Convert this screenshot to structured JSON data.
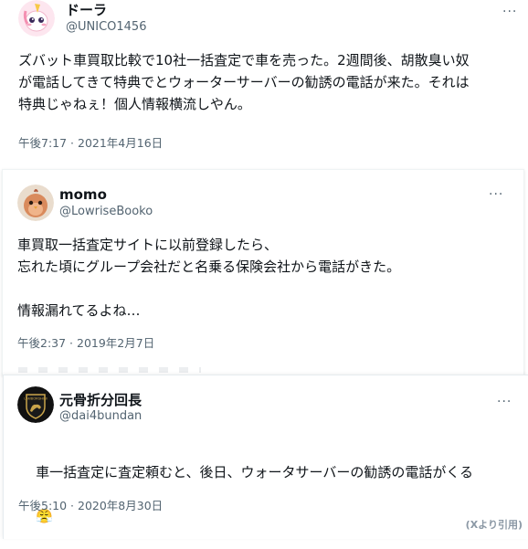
{
  "tweets": [
    {
      "name": "ドーラ",
      "handle": "@UNICO1456",
      "more_label": "···",
      "text": "ズバット車買取比較で10社一括査定で車を売った。2週間後、胡散臭い奴\nが電話してきて特典でとウォーターサーバーの勧誘の電話が来た。それは\n特典じゃねぇ！個人情報横流しやん。",
      "timestamp": "午後7:17 · 2021年4月16日",
      "avatar_icon": "unicorn-avatar"
    },
    {
      "name": "momo",
      "handle": "@LowriseBooko",
      "more_label": "···",
      "text": "車買取一括査定サイトに以前登録したら、\n忘れた頃にグループ会社だと名乗る保険会社から電話がきた。\n\n情報漏れてるよね…",
      "timestamp": "午後2:37 · 2019年2月7日",
      "avatar_icon": "bird-avatar"
    },
    {
      "name": "元骨折分回長",
      "handle": "@dai4bundan",
      "more_label": "···",
      "text": "車一括査定に査定頼むと、後日、ウォータサーバーの勧誘の電話がくる",
      "emoji": "😤",
      "timestamp": "午後5:10 · 2020年8月30日",
      "avatar_icon": "lamborghini-logo-avatar"
    }
  ],
  "source_label": "(Xより引用)",
  "colors": {
    "text": "#0f1419",
    "secondary": "#536471",
    "border": "#eff3f4"
  }
}
